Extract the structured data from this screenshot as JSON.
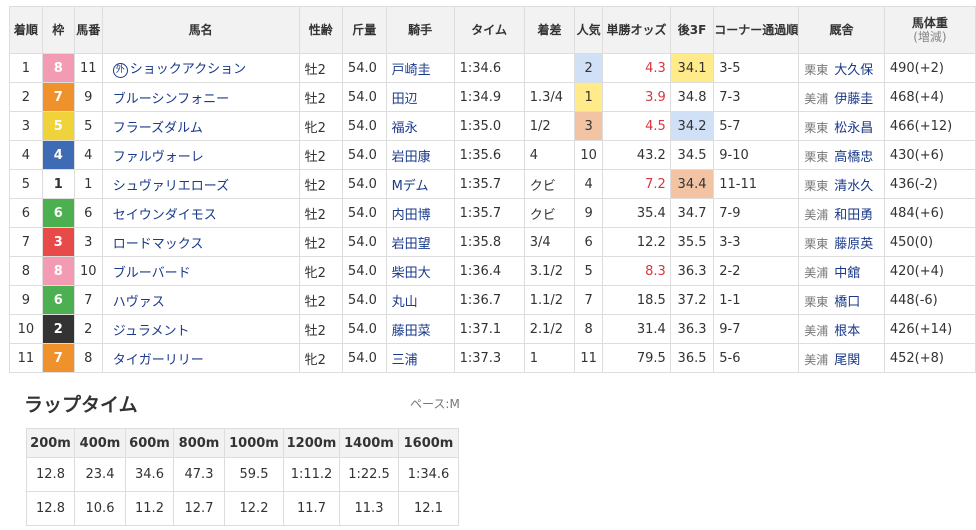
{
  "headers": {
    "finish": "着順",
    "waku": "枠",
    "umaban": "馬番",
    "horse": "馬名",
    "sexage": "性齢",
    "weight": "斤量",
    "jockey": "騎手",
    "time": "タイム",
    "margin": "着差",
    "pop": "人気",
    "odds": "単勝オッズ",
    "last3f": "後3F",
    "corner": "コーナー通過順",
    "trainer": "厩舎",
    "bodyweight": "馬体重",
    "bodyweight_sub": "(増減)"
  },
  "rows": [
    {
      "finish": "1",
      "waku": "8",
      "umaban": "11",
      "badge": "外",
      "horse": "ショックアクション",
      "sexage": "牡2",
      "weight": "54.0",
      "jockey": "戸崎圭",
      "time": "1:34.6",
      "margin": "",
      "pop": "2",
      "odds": "4.3",
      "last3f": "34.1",
      "corner": "3-5",
      "aff": "栗東",
      "trainer": "大久保",
      "bw": "490(+2)"
    },
    {
      "finish": "2",
      "waku": "7",
      "umaban": "9",
      "badge": "",
      "horse": "ブルーシンフォニー",
      "sexage": "牡2",
      "weight": "54.0",
      "jockey": "田辺",
      "time": "1:34.9",
      "margin": "1.3/4",
      "pop": "1",
      "odds": "3.9",
      "last3f": "34.8",
      "corner": "7-3",
      "aff": "美浦",
      "trainer": "伊藤圭",
      "bw": "468(+4)"
    },
    {
      "finish": "3",
      "waku": "5",
      "umaban": "5",
      "badge": "",
      "horse": "フラーズダルム",
      "sexage": "牝2",
      "weight": "54.0",
      "jockey": "福永",
      "time": "1:35.0",
      "margin": "1/2",
      "pop": "3",
      "odds": "4.5",
      "last3f": "34.2",
      "corner": "5-7",
      "aff": "栗東",
      "trainer": "松永昌",
      "bw": "466(+12)"
    },
    {
      "finish": "4",
      "waku": "4",
      "umaban": "4",
      "badge": "",
      "horse": "ファルヴォーレ",
      "sexage": "牡2",
      "weight": "54.0",
      "jockey": "岩田康",
      "time": "1:35.6",
      "margin": "4",
      "pop": "10",
      "odds": "43.2",
      "last3f": "34.5",
      "corner": "9-10",
      "aff": "栗東",
      "trainer": "高橋忠",
      "bw": "430(+6)"
    },
    {
      "finish": "5",
      "waku": "1",
      "umaban": "1",
      "badge": "",
      "horse": "シュヴァリエローズ",
      "sexage": "牡2",
      "weight": "54.0",
      "jockey": "Mデム",
      "time": "1:35.7",
      "margin": "クビ",
      "pop": "4",
      "odds": "7.2",
      "last3f": "34.4",
      "corner": "11-11",
      "aff": "栗東",
      "trainer": "清水久",
      "bw": "436(-2)"
    },
    {
      "finish": "6",
      "waku": "6",
      "umaban": "6",
      "badge": "",
      "horse": "セイウンダイモス",
      "sexage": "牡2",
      "weight": "54.0",
      "jockey": "内田博",
      "time": "1:35.7",
      "margin": "クビ",
      "pop": "9",
      "odds": "35.4",
      "last3f": "34.7",
      "corner": "7-9",
      "aff": "美浦",
      "trainer": "和田勇",
      "bw": "484(+6)"
    },
    {
      "finish": "7",
      "waku": "3",
      "umaban": "3",
      "badge": "",
      "horse": "ロードマックス",
      "sexage": "牡2",
      "weight": "54.0",
      "jockey": "岩田望",
      "time": "1:35.8",
      "margin": "3/4",
      "pop": "6",
      "odds": "12.2",
      "last3f": "35.5",
      "corner": "3-3",
      "aff": "栗東",
      "trainer": "藤原英",
      "bw": "450(0)"
    },
    {
      "finish": "8",
      "waku": "8",
      "umaban": "10",
      "badge": "",
      "horse": "ブルーバード",
      "sexage": "牝2",
      "weight": "54.0",
      "jockey": "柴田大",
      "time": "1:36.4",
      "margin": "3.1/2",
      "pop": "5",
      "odds": "8.3",
      "last3f": "36.3",
      "corner": "2-2",
      "aff": "美浦",
      "trainer": "中舘",
      "bw": "420(+4)"
    },
    {
      "finish": "9",
      "waku": "6",
      "umaban": "7",
      "badge": "",
      "horse": "ハヴァス",
      "sexage": "牡2",
      "weight": "54.0",
      "jockey": "丸山",
      "time": "1:36.7",
      "margin": "1.1/2",
      "pop": "7",
      "odds": "18.5",
      "last3f": "37.2",
      "corner": "1-1",
      "aff": "栗東",
      "trainer": "橋口",
      "bw": "448(-6)"
    },
    {
      "finish": "10",
      "waku": "2",
      "umaban": "2",
      "badge": "",
      "horse": "ジュラメント",
      "sexage": "牡2",
      "weight": "54.0",
      "jockey": "藤田菜",
      "time": "1:37.1",
      "margin": "2.1/2",
      "pop": "8",
      "odds": "31.4",
      "last3f": "36.3",
      "corner": "9-7",
      "aff": "美浦",
      "trainer": "根本",
      "bw": "426(+14)"
    },
    {
      "finish": "11",
      "waku": "7",
      "umaban": "8",
      "badge": "",
      "horse": "タイガーリリー",
      "sexage": "牝2",
      "weight": "54.0",
      "jockey": "三浦",
      "time": "1:37.3",
      "margin": "1",
      "pop": "11",
      "odds": "79.5",
      "last3f": "36.5",
      "corner": "5-6",
      "aff": "美浦",
      "trainer": "尾関",
      "bw": "452(+8)"
    }
  ],
  "lap": {
    "title": "ラップタイム",
    "pace": "ペース:M",
    "distances": [
      "200m",
      "400m",
      "600m",
      "800m",
      "1000m",
      "1200m",
      "1400m",
      "1600m"
    ],
    "cumulative": [
      "12.8",
      "23.4",
      "34.6",
      "47.3",
      "59.5",
      "1:11.2",
      "1:22.5",
      "1:34.6"
    ],
    "splits": [
      "12.8",
      "10.6",
      "11.2",
      "12.7",
      "12.2",
      "11.7",
      "11.3",
      "12.1"
    ]
  }
}
